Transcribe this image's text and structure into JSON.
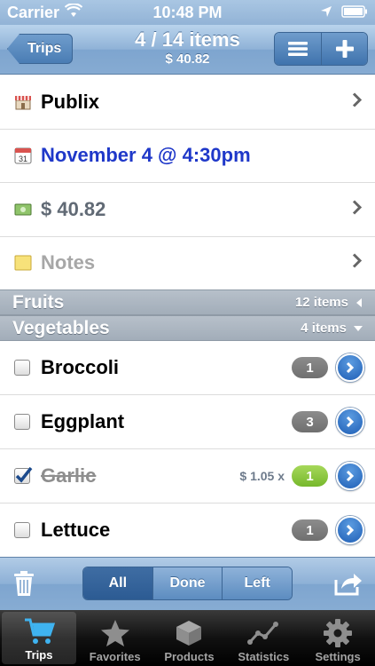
{
  "status_bar": {
    "carrier": "Carrier",
    "time": "10:48 PM"
  },
  "nav": {
    "back_label": "Trips",
    "title": "4 / 14 items",
    "subtitle": "$ 40.82"
  },
  "info_rows": {
    "store": "Publix",
    "date": "November 4 @ 4:30pm",
    "total": "$ 40.82",
    "notes": "Notes"
  },
  "sections": {
    "fruits": {
      "name": "Fruits",
      "count": "12 items"
    },
    "vegetables": {
      "name": "Vegetables",
      "count": "4 items"
    }
  },
  "items": [
    {
      "name": "Broccoli",
      "qty": "1",
      "checked": false,
      "price": ""
    },
    {
      "name": "Eggplant",
      "qty": "3",
      "checked": false,
      "price": ""
    },
    {
      "name": "Garlic",
      "qty": "1",
      "checked": true,
      "price": "$ 1.05 x"
    },
    {
      "name": "Lettuce",
      "qty": "1",
      "checked": false,
      "price": ""
    }
  ],
  "filter": {
    "all": "All",
    "done": "Done",
    "left": "Left",
    "selected": "All"
  },
  "tabs": {
    "trips": "Trips",
    "favorites": "Favorites",
    "products": "Products",
    "statistics": "Statistics",
    "settings": "Settings"
  },
  "colors": {
    "accent_blue": "#1f38c9",
    "nav_blue": "#86abd2",
    "qty_green": "#76b82c"
  }
}
